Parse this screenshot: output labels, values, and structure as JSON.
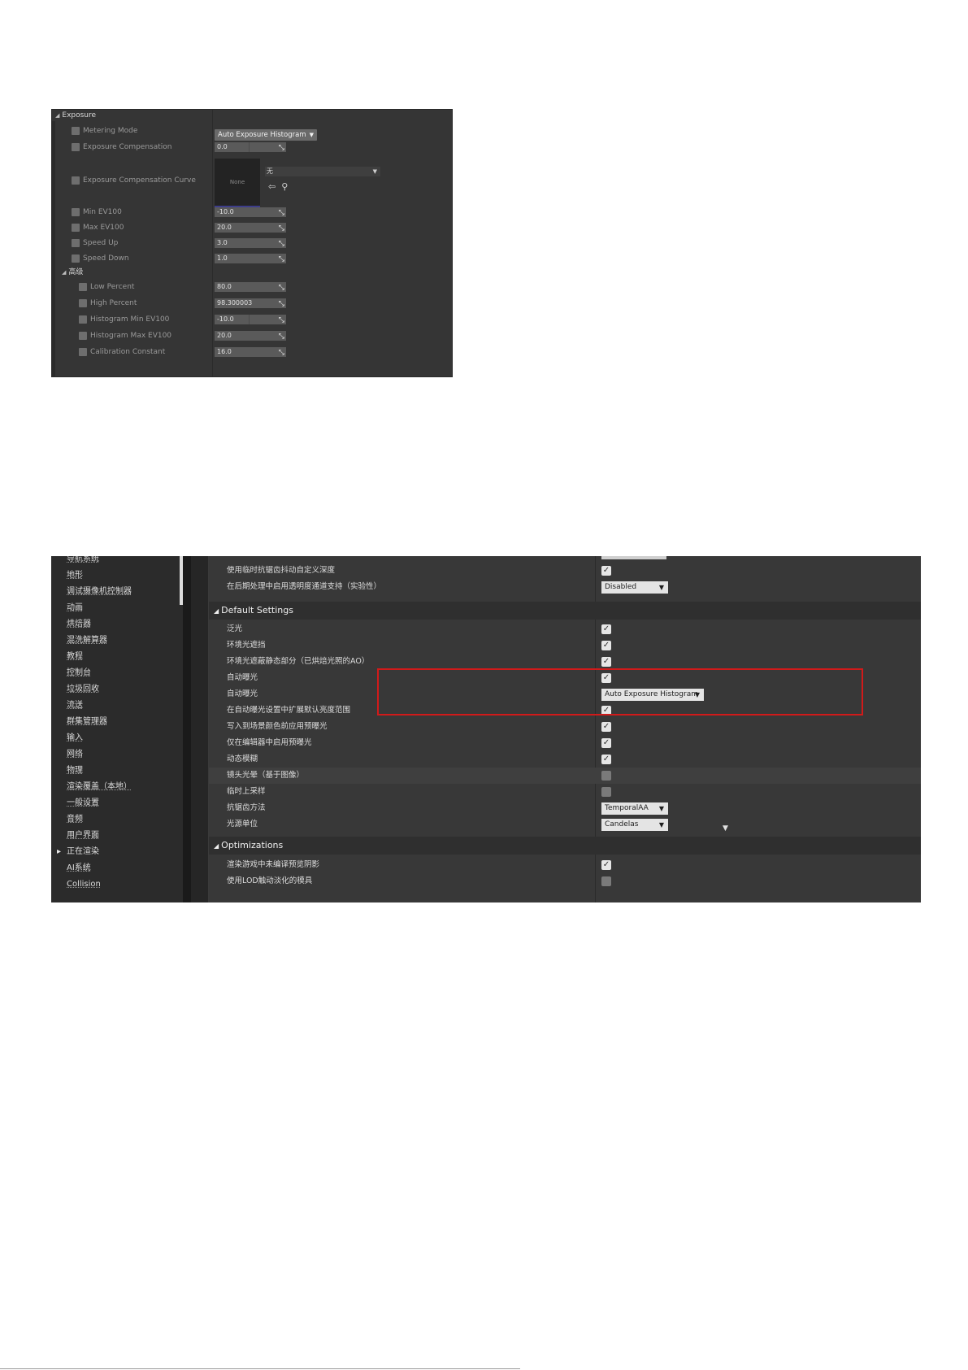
{
  "exposure_panel": {
    "category": "Exposure",
    "rows": [
      {
        "label": "Metering Mode"
      },
      {
        "label": "Exposure Compensation",
        "value": "0.0"
      },
      {
        "label": "Exposure Compensation Curve"
      },
      {
        "label": "Min EV100",
        "value": "-10.0"
      },
      {
        "label": "Max EV100",
        "value": "20.0"
      },
      {
        "label": "Speed Up",
        "value": "3.0"
      },
      {
        "label": "Speed Down",
        "value": "1.0"
      }
    ],
    "metering_value": "Auto Exposure Histogram",
    "curve_thumb": "None",
    "curve_asset": "无",
    "advanced_category": "高级",
    "advanced_rows": [
      {
        "label": "Low Percent",
        "value": "80.0"
      },
      {
        "label": "High Percent",
        "value": "98.300003"
      },
      {
        "label": "Histogram Min EV100",
        "value": "-10.0"
      },
      {
        "label": "Histogram Max EV100",
        "value": "20.0"
      },
      {
        "label": "Calibration Constant",
        "value": "16.0"
      }
    ]
  },
  "settings_panel": {
    "sidebar": [
      "导航系统",
      "地形",
      "调试摄像机控制器",
      "动画",
      "烘焙器",
      "混洗解算器",
      "教程",
      "控制台",
      "垃圾回收",
      "流送",
      "群集管理器",
      "输入",
      "网络",
      "物理",
      "渲染覆盖（本地）",
      "一般设置",
      "音频",
      "用户界面",
      "正在渲染",
      "AI系统",
      "Collision"
    ],
    "rows_top": [
      {
        "label": "使用临时抗锯齿抖动自定义深度",
        "check": true
      },
      {
        "label": "在后期处理中启用透明度通道支持（实验性）",
        "dropdown": "Disabled"
      }
    ],
    "section_default": "Default Settings",
    "rows_default": [
      {
        "label": "泛光",
        "check": true
      },
      {
        "label": "环境光遮挡",
        "check": true
      },
      {
        "label": "环境光遮蔽静态部分（已烘焙光照的AO）",
        "check": true
      },
      {
        "label": "自动曝光",
        "check": true
      },
      {
        "label": "自动曝光",
        "dropdown": "Auto Exposure Histogram"
      },
      {
        "label": "在自动曝光设置中扩展默认亮度范围",
        "check": true
      },
      {
        "label": "写入到场景颜色前应用预曝光",
        "check": true
      },
      {
        "label": "仅在编辑器中启用预曝光",
        "check": true
      },
      {
        "label": "动态模糊",
        "check": true
      },
      {
        "label": "镜头光晕（基于图像）",
        "check": false
      },
      {
        "label": "临时上采样",
        "check": false
      },
      {
        "label": "抗锯齿方法",
        "dropdown": "TemporalAA"
      },
      {
        "label": "光源单位",
        "dropdown": "Candelas"
      }
    ],
    "section_opt": "Optimizations",
    "rows_opt": [
      {
        "label": "渲染游戏中未编译预览阴影",
        "check": true
      },
      {
        "label": "使用LOD触动淡化的模具",
        "check": false
      }
    ]
  }
}
